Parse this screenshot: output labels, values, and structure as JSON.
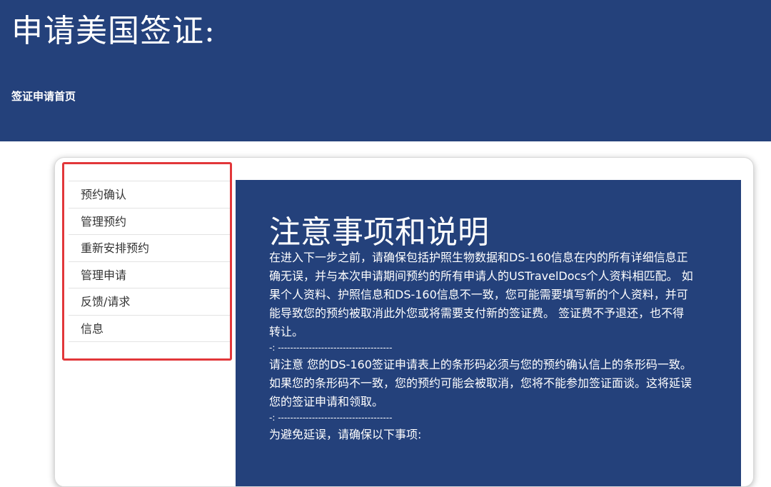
{
  "header": {
    "title": "申请美国签证:",
    "breadcrumb": "签证申请首页"
  },
  "sidebar": {
    "items": [
      {
        "label": "预约确认"
      },
      {
        "label": "管理预约"
      },
      {
        "label": "重新安排预约"
      },
      {
        "label": "管理申请"
      },
      {
        "label": "反馈/请求"
      },
      {
        "label": "信息"
      }
    ]
  },
  "content": {
    "heading": "注意事项和说明",
    "paragraph1": "在进入下一步之前，请确保包括护照生物数据和DS-160信息在内的所有详细信息正确无误，并与本次申请期间预约的所有申请人的USTravelDocs个人资料相匹配。 如果个人资料、护照信息和DS-160信息不一致，您可能需要填写新的个人资料，并可能导致您的预约被取消此外您或将需要支付新的签证费。 签证费不予退还，也不得转让。",
    "separator1": "-: -------------------------------------",
    "paragraph2": "请注意 您的DS-160签证申请表上的条形码必须与您的预约确认信上的条形码一致。 如果您的条形码不一致，您的预约可能会被取消，您将不能参加签证面谈。这将延误您的签证申请和领取。",
    "separator2": "-: -------------------------------------",
    "paragraph3": "为避免延误，请确保以下事项:"
  },
  "colors": {
    "navy": "#24417b",
    "highlight_border": "#e2373a"
  }
}
